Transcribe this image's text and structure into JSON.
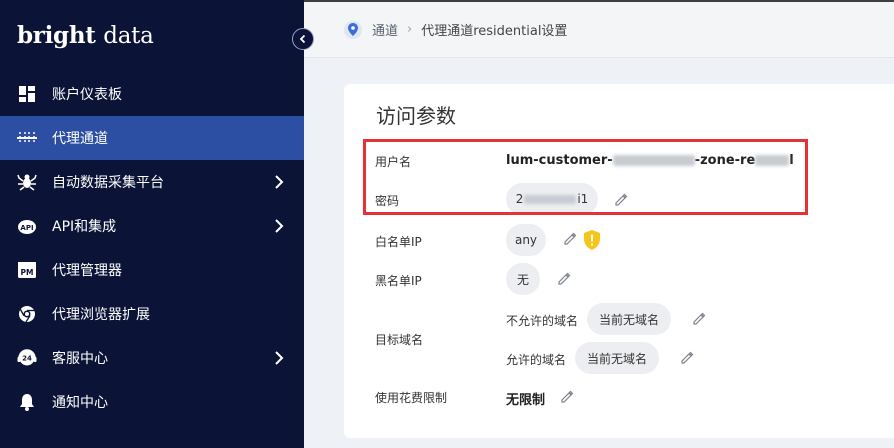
{
  "brand": {
    "name_bold": "bright",
    "name_light": "data"
  },
  "sidebar": {
    "items": [
      {
        "label": "账户仪表板",
        "icon": "dashboard-icon",
        "active": false,
        "has_chevron": false
      },
      {
        "label": "代理通道",
        "icon": "proxy-icon",
        "active": true,
        "has_chevron": false
      },
      {
        "label": "自动数据采集平台",
        "icon": "spider-icon",
        "active": false,
        "has_chevron": true
      },
      {
        "label": "API和集成",
        "icon": "api-icon",
        "active": false,
        "has_chevron": true
      },
      {
        "label": "代理管理器",
        "icon": "pm-icon",
        "active": false,
        "has_chevron": false
      },
      {
        "label": "代理浏览器扩展",
        "icon": "chrome-icon",
        "active": false,
        "has_chevron": false
      },
      {
        "label": "客服中心",
        "icon": "support-24-icon",
        "active": false,
        "has_chevron": true
      },
      {
        "label": "通知中心",
        "icon": "bell-icon",
        "active": false,
        "has_chevron": false
      }
    ]
  },
  "breadcrumb": {
    "root": "通道",
    "current": "代理通道residential设置"
  },
  "card": {
    "title": "访问参数",
    "username_label": "用户名",
    "username_prefix": "lum-customer-",
    "username_mid": "-zone-re",
    "password_label": "密码",
    "password_prefix": "2",
    "password_suffix": "i1",
    "whitelist_label": "白名单IP",
    "whitelist_value": "any",
    "blacklist_label": "黑名单IP",
    "blacklist_value": "无",
    "target_domain_label": "目标域名",
    "disallowed_label": "不允许的域名",
    "disallowed_value": "当前无域名",
    "allowed_label": "允许的域名",
    "allowed_value": "当前无域名",
    "spend_limit_label": "使用花费限制",
    "spend_limit_value": "无限制"
  },
  "colors": {
    "sidebar_bg": "#0b1437",
    "active_bg": "#2d4fa3",
    "highlight_border": "#e53335",
    "warning": "#f5c518"
  }
}
